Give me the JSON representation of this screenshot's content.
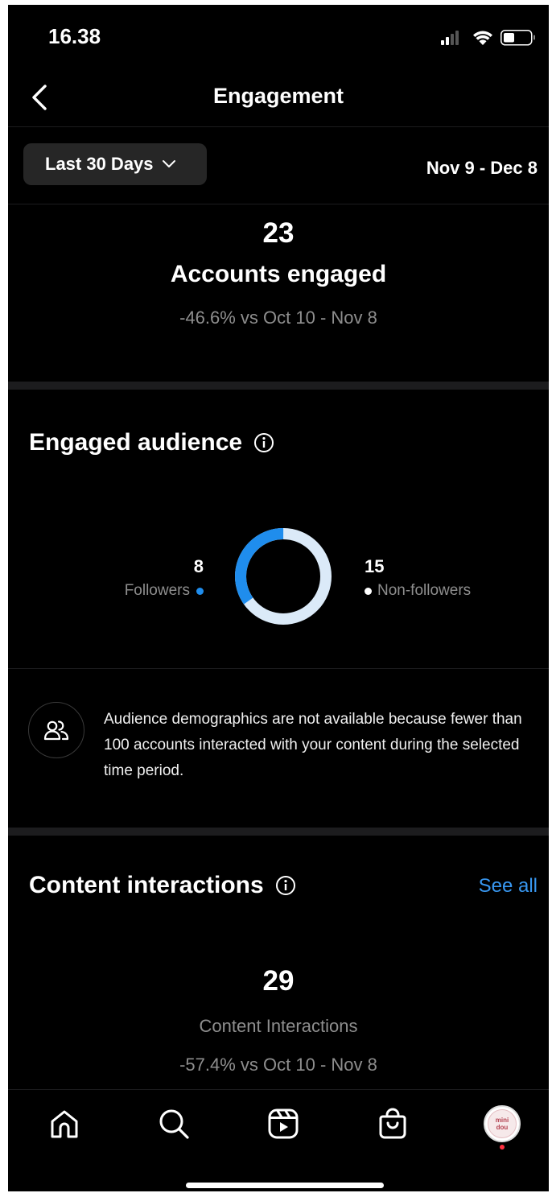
{
  "status_bar": {
    "time": "16.38"
  },
  "header": {
    "title": "Engagement"
  },
  "filter": {
    "range_label": "Last 30 Days",
    "date_range": "Nov 9 - Dec 8"
  },
  "accounts_engaged": {
    "value": "23",
    "label": "Accounts engaged",
    "comparison": "-46.6% vs Oct 10 - Nov 8"
  },
  "engaged_audience": {
    "title": "Engaged audience",
    "followers": {
      "value": "8",
      "label": "Followers",
      "color": "#1f8ded"
    },
    "non_followers": {
      "value": "15",
      "label": "Non-followers",
      "color": "#dbeaf8"
    },
    "notice": "Audience demographics are not available because fewer than 100 accounts interacted with your content during the selected time period."
  },
  "content_interactions": {
    "title": "Content interactions",
    "see_all": "See all",
    "value": "29",
    "label": "Content Interactions",
    "comparison": "-57.4% vs Oct 10 - Nov 8"
  },
  "tab_bar": {
    "items": [
      "home-icon",
      "search-icon",
      "reels-icon",
      "shop-icon",
      "profile-avatar"
    ],
    "avatar_text_line1": "mini",
    "avatar_text_line2": "dou"
  },
  "colors": {
    "accent": "#3897f0",
    "background": "#000000"
  }
}
